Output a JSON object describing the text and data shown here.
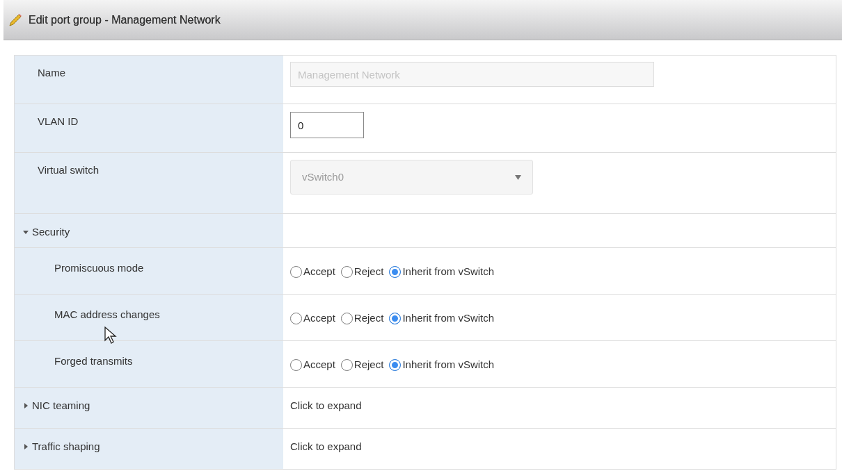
{
  "window": {
    "title": "Edit port group - Management Network"
  },
  "rows": [
    {
      "kind": "text",
      "label": "Name",
      "value": "Management Network",
      "disabled": true
    },
    {
      "kind": "number",
      "label": "VLAN ID",
      "value": "0",
      "disabled": false
    },
    {
      "kind": "select",
      "label": "Virtual switch",
      "value": "vSwitch0",
      "disabled": true
    },
    {
      "kind": "section",
      "label": "Security",
      "expanded": true,
      "children": [
        {
          "label": "Promiscuous mode",
          "options": [
            {
              "label": "Accept",
              "selected": false
            },
            {
              "label": "Reject",
              "selected": false
            },
            {
              "label": "Inherit from vSwitch",
              "selected": true
            }
          ]
        },
        {
          "label": "MAC address changes",
          "options": [
            {
              "label": "Accept",
              "selected": false
            },
            {
              "label": "Reject",
              "selected": false
            },
            {
              "label": "Inherit from vSwitch",
              "selected": true
            }
          ]
        },
        {
          "label": "Forged transmits",
          "options": [
            {
              "label": "Accept",
              "selected": false
            },
            {
              "label": "Reject",
              "selected": false
            },
            {
              "label": "Inherit from vSwitch",
              "selected": true
            }
          ]
        }
      ]
    },
    {
      "kind": "section",
      "label": "NIC teaming",
      "expanded": false,
      "value": "Click to expand"
    },
    {
      "kind": "section",
      "label": "Traffic shaping",
      "expanded": false,
      "value": "Click to expand"
    }
  ]
}
